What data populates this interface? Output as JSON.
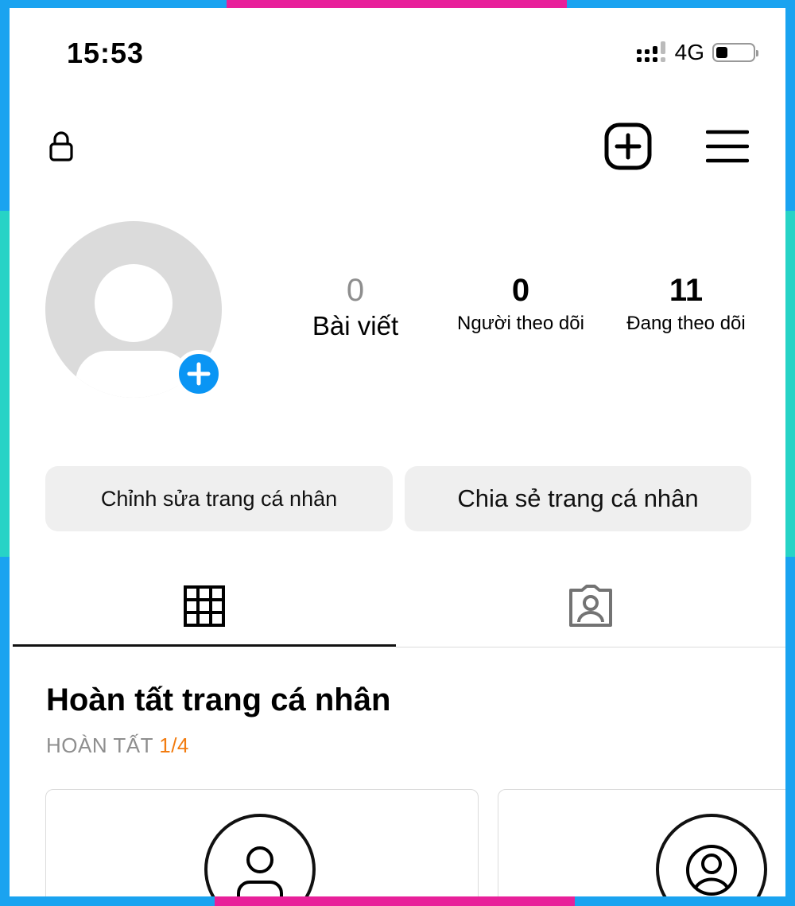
{
  "status_bar": {
    "time": "15:53",
    "network": "4G",
    "battery_level": 0.3
  },
  "header": {
    "icons": [
      "lock-icon",
      "add-post-icon",
      "menu-icon"
    ]
  },
  "profile": {
    "stats": [
      {
        "value": "0",
        "label": "Bài viết"
      },
      {
        "value": "0",
        "label": "Người theo dõi"
      },
      {
        "value": "11",
        "label": "Đang theo dõi"
      }
    ]
  },
  "actions": {
    "edit_label": "Chỉnh sửa trang cá nhân",
    "share_label": "Chia sẻ trang cá nhân"
  },
  "tabs": [
    "grid-icon",
    "tagged-icon"
  ],
  "completion": {
    "title": "Hoàn tất trang cá nhân",
    "prefix": "HOÀN TẤT",
    "count": "1/4"
  },
  "colors": {
    "accent_blue": "#0a95f4",
    "progress_orange": "#f27c10",
    "button_bg": "#efefef"
  }
}
